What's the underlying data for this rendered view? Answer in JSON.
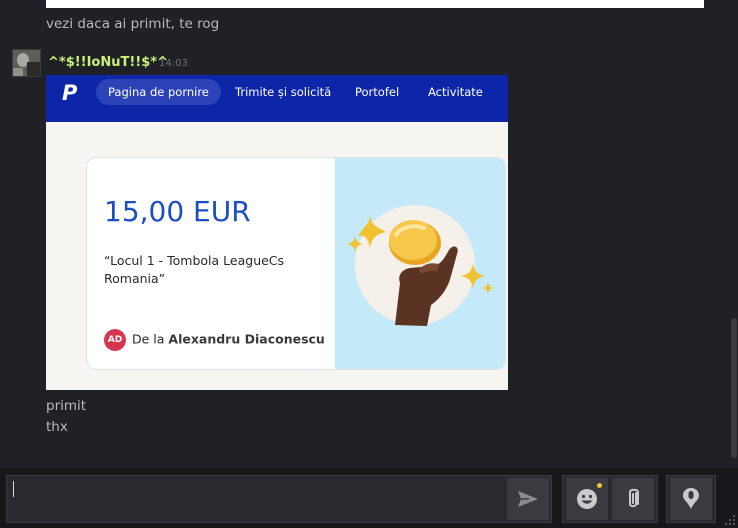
{
  "messages": {
    "previous_text": "vezi daca ai primit, te rog",
    "sender": {
      "username": "^*$!!IoNuT!!$*^",
      "time": "14:03"
    },
    "followups": [
      "primit",
      "thx"
    ]
  },
  "screenshot": {
    "logo": "P",
    "tabs": [
      "Pagina de pornire",
      "Trimite și solicită",
      "Portofel",
      "Activitate"
    ],
    "active_tab": "Pagina de pornire",
    "amount": "15,00 EUR",
    "note": "“Locul 1 - Tombola LeagueCs Romania”",
    "from_label": "De la",
    "from_name": "Alexandru Diaconescu",
    "from_initials": "AD"
  },
  "composer": {
    "value": "",
    "icons": [
      "send-icon",
      "emoji-icon",
      "attach-icon",
      "voice-icon"
    ]
  },
  "colors": {
    "paypal_blue": "#0d26a7",
    "amount_blue": "#1d4fc4",
    "username_green": "#c9f07a",
    "notification_dot": "#f2c232"
  }
}
